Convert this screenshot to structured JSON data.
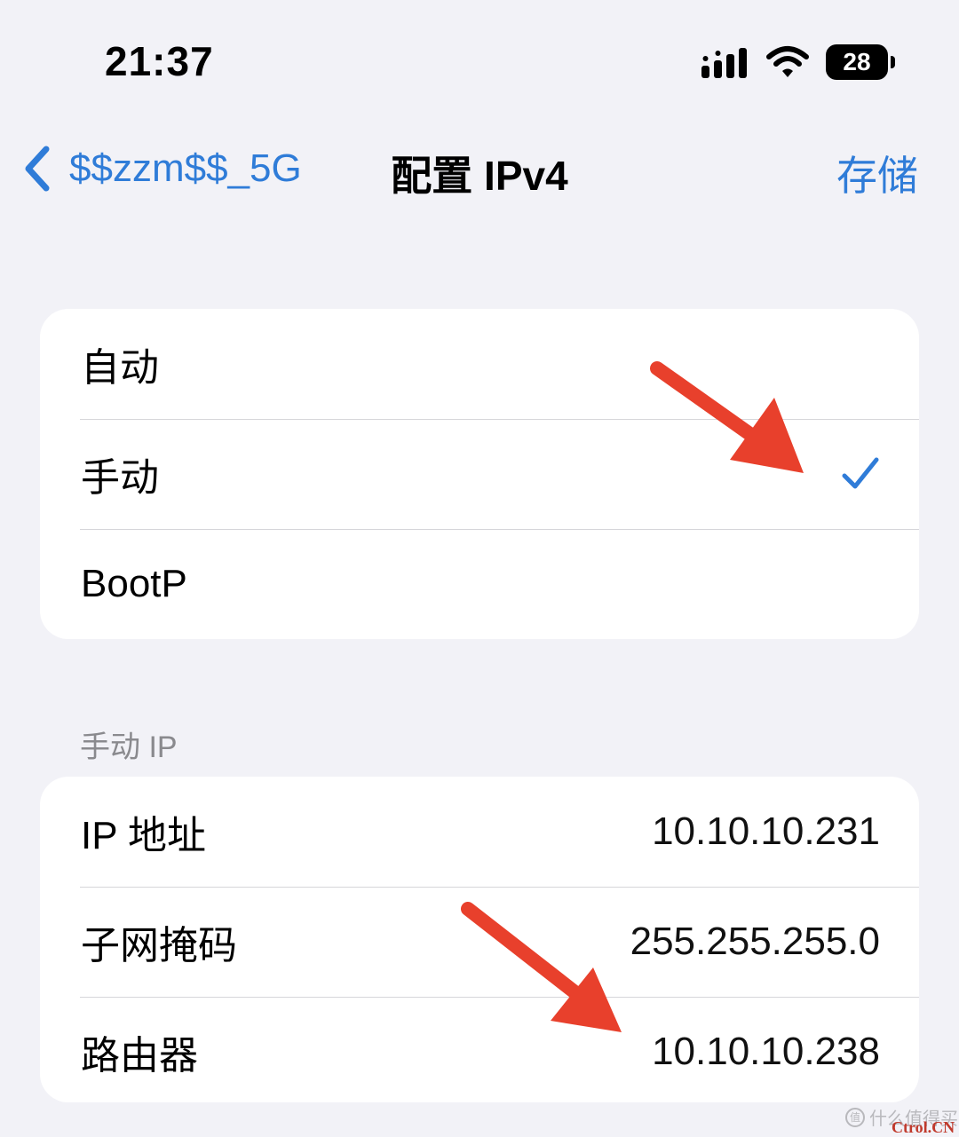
{
  "status_bar": {
    "time": "21:37",
    "battery_level": "28",
    "icons": [
      "cellular-signal-icon",
      "wifi-icon",
      "battery-icon"
    ]
  },
  "nav": {
    "back_label": "$$zzm$$_5G",
    "title": "配置 IPv4",
    "save_label": "存储"
  },
  "mode_group": {
    "options": [
      {
        "label": "自动",
        "selected": false
      },
      {
        "label": "手动",
        "selected": true
      },
      {
        "label": "BootP",
        "selected": false
      }
    ]
  },
  "manual_ip": {
    "header": "手动 IP",
    "rows": [
      {
        "label": "IP 地址",
        "value": "10.10.10.231"
      },
      {
        "label": "子网掩码",
        "value": "255.255.255.0"
      },
      {
        "label": "路由器",
        "value": "10.10.10.238"
      }
    ]
  },
  "colors": {
    "accent": "#2f7cd8",
    "background": "#f2f2f7",
    "annotation_arrow": "#e8402c"
  },
  "watermarks": {
    "site": "什么值得买",
    "brand": "Ctrol.CN"
  }
}
